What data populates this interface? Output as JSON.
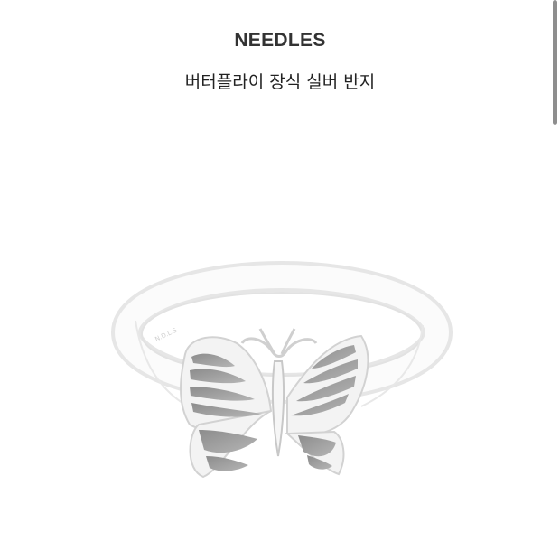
{
  "product": {
    "brand": "NEEDLES",
    "name": "버터플라이 장식 실버 반지"
  },
  "image": {
    "subject": "ring-icon"
  }
}
